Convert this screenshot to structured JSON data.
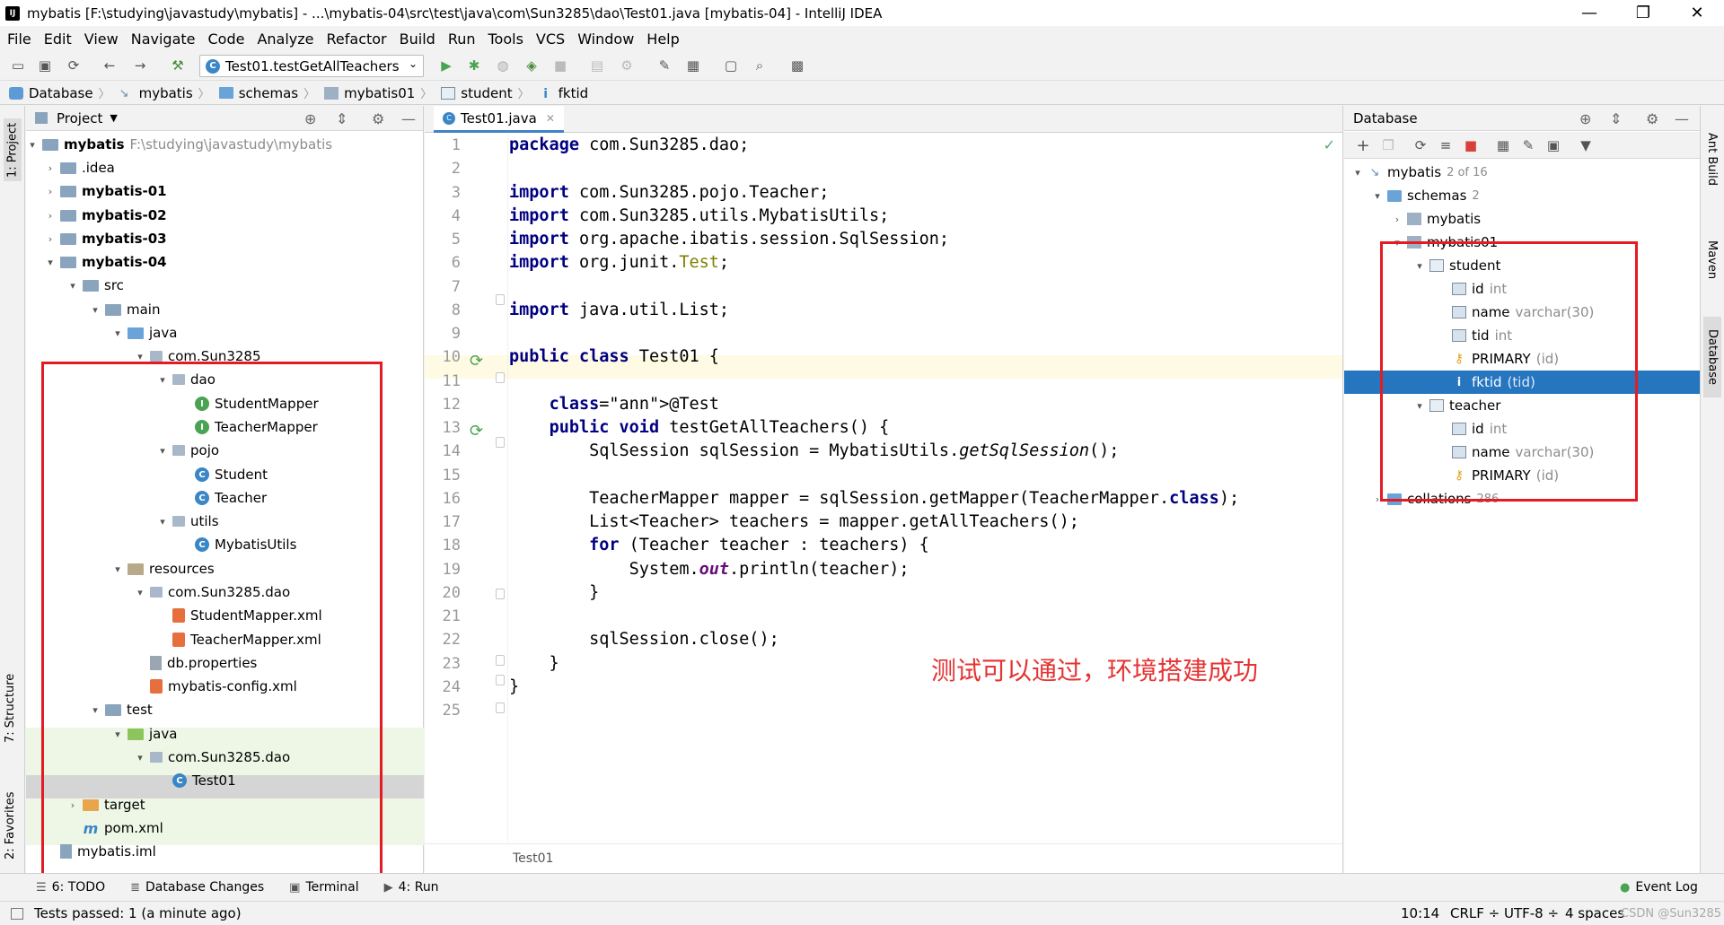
{
  "window": {
    "title": "mybatis [F:\\studying\\javastudy\\mybatis] - ...\\mybatis-04\\src\\test\\java\\com\\Sun3285\\dao\\Test01.java [mybatis-04] - IntelliJ IDEA",
    "minimize": "—",
    "maximize": "❐",
    "close": "✕"
  },
  "menu": [
    "File",
    "Edit",
    "View",
    "Navigate",
    "Code",
    "Analyze",
    "Refactor",
    "Build",
    "Run",
    "Tools",
    "VCS",
    "Window",
    "Help"
  ],
  "toolbar": {
    "run_config": "Test01.testGetAllTeachers"
  },
  "breadcrumb": [
    "Database",
    "mybatis",
    "schemas",
    "mybatis01",
    "student",
    "fktid"
  ],
  "left_stripe": {
    "project": "1: Project",
    "structure": "7: Structure",
    "favorites": "2: Favorites"
  },
  "right_stripe": {
    "ant": "Ant Build",
    "maven": "Maven",
    "database": "Database"
  },
  "project_panel": {
    "title": "Project",
    "tree": [
      {
        "label": "mybatis",
        "extra": "F:\\studying\\javastudy\\mybatis",
        "bold": true
      },
      {
        "label": ".idea"
      },
      {
        "label": "mybatis-01",
        "bold": true
      },
      {
        "label": "mybatis-02",
        "bold": true
      },
      {
        "label": "mybatis-03",
        "bold": true
      },
      {
        "label": "mybatis-04",
        "bold": true
      },
      {
        "label": "src"
      },
      {
        "label": "main"
      },
      {
        "label": "java"
      },
      {
        "label": "com.Sun3285"
      },
      {
        "label": "dao"
      },
      {
        "label": "StudentMapper"
      },
      {
        "label": "TeacherMapper"
      },
      {
        "label": "pojo"
      },
      {
        "label": "Student"
      },
      {
        "label": "Teacher"
      },
      {
        "label": "utils"
      },
      {
        "label": "MybatisUtils"
      },
      {
        "label": "resources"
      },
      {
        "label": "com.Sun3285.dao"
      },
      {
        "label": "StudentMapper.xml"
      },
      {
        "label": "TeacherMapper.xml"
      },
      {
        "label": "db.properties"
      },
      {
        "label": "mybatis-config.xml"
      },
      {
        "label": "test"
      },
      {
        "label": "java"
      },
      {
        "label": "com.Sun3285.dao"
      },
      {
        "label": "Test01"
      },
      {
        "label": "target"
      },
      {
        "label": "pom.xml"
      },
      {
        "label": "mybatis.iml"
      }
    ]
  },
  "editor": {
    "tab": "Test01.java",
    "line_numbers": [
      "1",
      "2",
      "3",
      "4",
      "5",
      "6",
      "7",
      "8",
      "9",
      "10",
      "11",
      "12",
      "13",
      "14",
      "15",
      "16",
      "17",
      "18",
      "19",
      "20",
      "21",
      "22",
      "23",
      "24",
      "25"
    ],
    "code": [
      "package com.Sun3285.dao;",
      "",
      "import com.Sun3285.pojo.Teacher;",
      "import com.Sun3285.utils.MybatisUtils;",
      "import org.apache.ibatis.session.SqlSession;",
      "import org.junit.Test;",
      "",
      "import java.util.List;",
      "",
      "public class Test01 {",
      "",
      "    @Test",
      "    public void testGetAllTeachers() {",
      "        SqlSession sqlSession = MybatisUtils.getSqlSession();",
      "",
      "        TeacherMapper mapper = sqlSession.getMapper(TeacherMapper.class);",
      "        List<Teacher> teachers = mapper.getAllTeachers();",
      "        for (Teacher teacher : teachers) {",
      "            System.out.println(teacher);",
      "        }",
      "",
      "        sqlSession.close();",
      "    }",
      "}",
      ""
    ],
    "annotation": "测试可以通过，环境搭建成功",
    "footer_crumb": "Test01"
  },
  "database_panel": {
    "title": "Database",
    "tree": [
      {
        "label": "mybatis",
        "extra": "2 of 16"
      },
      {
        "label": "schemas",
        "extra": "2"
      },
      {
        "label": "mybatis",
        "extra": ""
      },
      {
        "label": "mybatis01",
        "extra": ""
      },
      {
        "label": "student",
        "extra": ""
      },
      {
        "label": "id",
        "extra": "int"
      },
      {
        "label": "name",
        "extra": "varchar(30)"
      },
      {
        "label": "tid",
        "extra": "int"
      },
      {
        "label": "PRIMARY",
        "extra": "(id)"
      },
      {
        "label": "fktid",
        "extra": "(tid)"
      },
      {
        "label": "teacher",
        "extra": ""
      },
      {
        "label": "id",
        "extra": "int"
      },
      {
        "label": "name",
        "extra": "varchar(30)"
      },
      {
        "label": "PRIMARY",
        "extra": "(id)"
      },
      {
        "label": "collations",
        "extra": "286"
      }
    ]
  },
  "bottom_tabs": {
    "todo": "6: TODO",
    "db_changes": "Database Changes",
    "terminal": "Terminal",
    "run": "4: Run",
    "event_log": "Event Log"
  },
  "status": {
    "message": "Tests passed: 1 (a minute ago)",
    "position": "10:14",
    "line_sep": "CRLF ÷",
    "encoding": "UTF-8 ÷",
    "indent": "4 spaces",
    "watermark": "CSDN @Sun3285"
  }
}
